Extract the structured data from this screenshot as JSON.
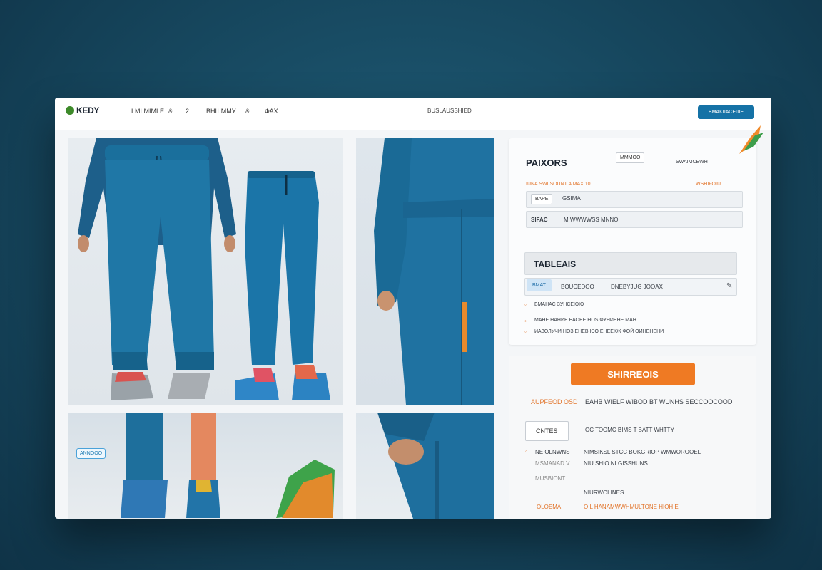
{
  "header": {
    "logo_text": "KEDY",
    "nav": [
      "LMLMIMLE",
      "2",
      "ВНШММУ",
      "ФАХ"
    ],
    "nav_seps": [
      "&",
      "&",
      "&"
    ],
    "center_label": "BUSLAUSSHIED",
    "button_label": "ВМАКЛАСЕШЕ"
  },
  "gallery": {
    "badge": "ANNOOO"
  },
  "details": {
    "title": "PAIXORS",
    "tab_chip": "MMMOO",
    "tab_right": "SWAIMCEWH",
    "section_label_orange": "IUNA SWI SOUNT A MAX 10",
    "section_label_right": "WSHIFOIU",
    "option1_chip": "ВАРЕ",
    "option1_text": "GSIMA",
    "option2_label": "SIFAC",
    "option2_text": "M WWWWSS MNNO",
    "subtitle": "TABLEAIS",
    "size_tab_active": "ВМАТ",
    "size_tab_2": "BOUCEDOO",
    "size_tab_3": "DNEBYJUG JOOAX",
    "info_lines": [
      "БМАНАС ЗУНСЕЮЮ",
      "МАНЕ НАНИЕ БАОЕЕ НОS ФУНИЕНЕ МАН",
      "ИАЗОЛУЧИ НОЗ ЕНЕВ ЮО ЕНЕЕКЖ ФОЙ ОИНЕНЕНИ"
    ]
  },
  "checkout": {
    "cta_label": "SHIRREOIS",
    "meta_orange": "AUPFEOD OSD",
    "meta_text": "EAHB WIELF WIBOD BT WUNHS SECCOOCOOD",
    "chip": "CNTES",
    "chip_text": "OC TOOMC BIMS T BATT WHTTY",
    "rows": [
      {
        "left": "NE OLNWNS",
        "right": "NIMSIKSL STCC BOKGRIOP WMWOROOEL"
      },
      {
        "left": "MSMANAD V",
        "right": "NIU SHIO NLGISSHUNS"
      },
      {
        "left": "MUSBIONT",
        "right": ""
      },
      {
        "left": "",
        "right": "NIURWOLINES"
      }
    ],
    "footer_left": "OLOEMA",
    "footer_right": "OIL HANAMWWHMULTONE HIOHIE"
  },
  "colors": {
    "accent_blue": "#1572a6",
    "accent_orange": "#ef7a23",
    "pants_blue": "#1f6e9b"
  }
}
